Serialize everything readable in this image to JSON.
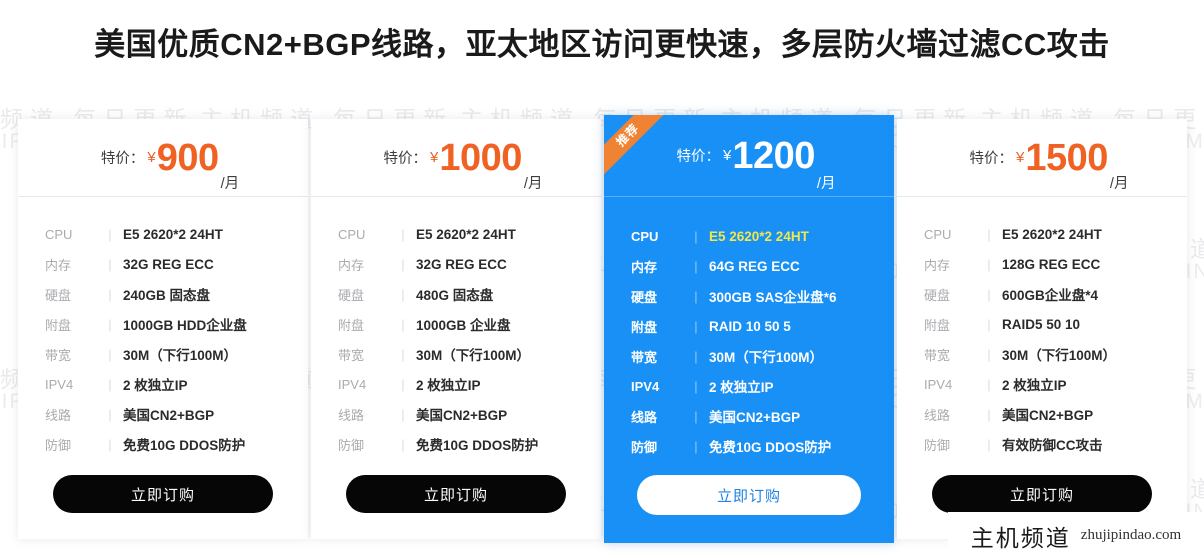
{
  "header": {
    "title": "美国优质CN2+BGP线路，亚太地区访问更快速，多层防火墙过滤CC攻击"
  },
  "background_watermark": {
    "cn": "主机频道 每日更新",
    "en": "ZHUJIPINDAO.COM"
  },
  "corner_watermark": {
    "cn": "主机频道",
    "en": "zhujipindao.com"
  },
  "colors": {
    "price_orange": "#ef6223",
    "featured_blue": "#1890f6",
    "ribbon_orange": "#f08333",
    "accent_yellow": "#f3e74a",
    "button_black": "#060606"
  },
  "price_prefix": "特价：",
  "currency": "¥",
  "price_unit": "/月",
  "spec_separator": "|",
  "cards": [
    {
      "price": "900",
      "featured": false,
      "ribbon": "",
      "buy_label": "立即订购",
      "specs": [
        {
          "label": "CPU",
          "value": "E5 2620*2 24HT"
        },
        {
          "label": "内存",
          "value": "32G REG ECC"
        },
        {
          "label": "硬盘",
          "value": "240GB 固态盘"
        },
        {
          "label": "附盘",
          "value": "1000GB HDD企业盘"
        },
        {
          "label": "带宽",
          "value": "30M（下行100M）"
        },
        {
          "label": "IPV4",
          "value": "2 枚独立IP"
        },
        {
          "label": "线路",
          "value": "美国CN2+BGP"
        },
        {
          "label": "防御",
          "value": "免费10G DDOS防护"
        }
      ]
    },
    {
      "price": "1000",
      "featured": false,
      "ribbon": "",
      "buy_label": "立即订购",
      "specs": [
        {
          "label": "CPU",
          "value": "E5 2620*2 24HT"
        },
        {
          "label": "内存",
          "value": "32G REG ECC"
        },
        {
          "label": "硬盘",
          "value": "480G 固态盘"
        },
        {
          "label": "附盘",
          "value": "1000GB 企业盘"
        },
        {
          "label": "带宽",
          "value": "30M（下行100M）"
        },
        {
          "label": "IPV4",
          "value": "2 枚独立IP"
        },
        {
          "label": "线路",
          "value": "美国CN2+BGP"
        },
        {
          "label": "防御",
          "value": "免费10G DDOS防护"
        }
      ]
    },
    {
      "price": "1200",
      "featured": true,
      "ribbon": "推荐",
      "buy_label": "立即订购",
      "specs": [
        {
          "label": "CPU",
          "value": "E5 2620*2 24HT",
          "accent": true
        },
        {
          "label": "内存",
          "value": "64G REG ECC"
        },
        {
          "label": "硬盘",
          "value": "300GB SAS企业盘*6"
        },
        {
          "label": "附盘",
          "value": "RAID 10 50 5"
        },
        {
          "label": "带宽",
          "value": "30M（下行100M）"
        },
        {
          "label": "IPV4",
          "value": "2 枚独立IP"
        },
        {
          "label": "线路",
          "value": "美国CN2+BGP"
        },
        {
          "label": "防御",
          "value": "免费10G DDOS防护"
        }
      ]
    },
    {
      "price": "1500",
      "featured": false,
      "ribbon": "",
      "buy_label": "立即订购",
      "specs": [
        {
          "label": "CPU",
          "value": "E5 2620*2 24HT"
        },
        {
          "label": "内存",
          "value": "128G REG ECC"
        },
        {
          "label": "硬盘",
          "value": "600GB企业盘*4"
        },
        {
          "label": "附盘",
          "value": "RAID5 50 10"
        },
        {
          "label": "带宽",
          "value": "30M（下行100M）"
        },
        {
          "label": "IPV4",
          "value": "2 枚独立IP"
        },
        {
          "label": "线路",
          "value": "美国CN2+BGP"
        },
        {
          "label": "防御",
          "value": "有效防御CC攻击"
        }
      ]
    }
  ]
}
